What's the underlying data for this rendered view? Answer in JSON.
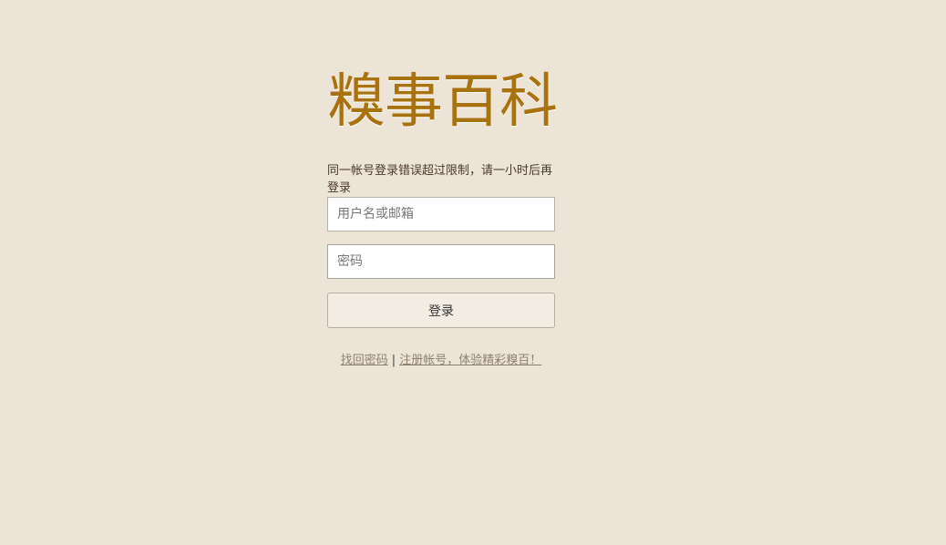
{
  "logo": {
    "text": "糗事百科"
  },
  "login": {
    "error_message": "同一帐号登录错误超过限制，请一小时后再登录",
    "username_placeholder": "用户名或邮箱",
    "password_placeholder": "密码",
    "submit_label": "登录"
  },
  "links": {
    "forgot_password": "找回密码",
    "separator": "|",
    "register": "注册帐号，体验精彩糗百！"
  },
  "colors": {
    "background": "#ede4d8",
    "logo": "#a8720f",
    "link": "#8e8170",
    "button_bg": "#f2ece2"
  }
}
